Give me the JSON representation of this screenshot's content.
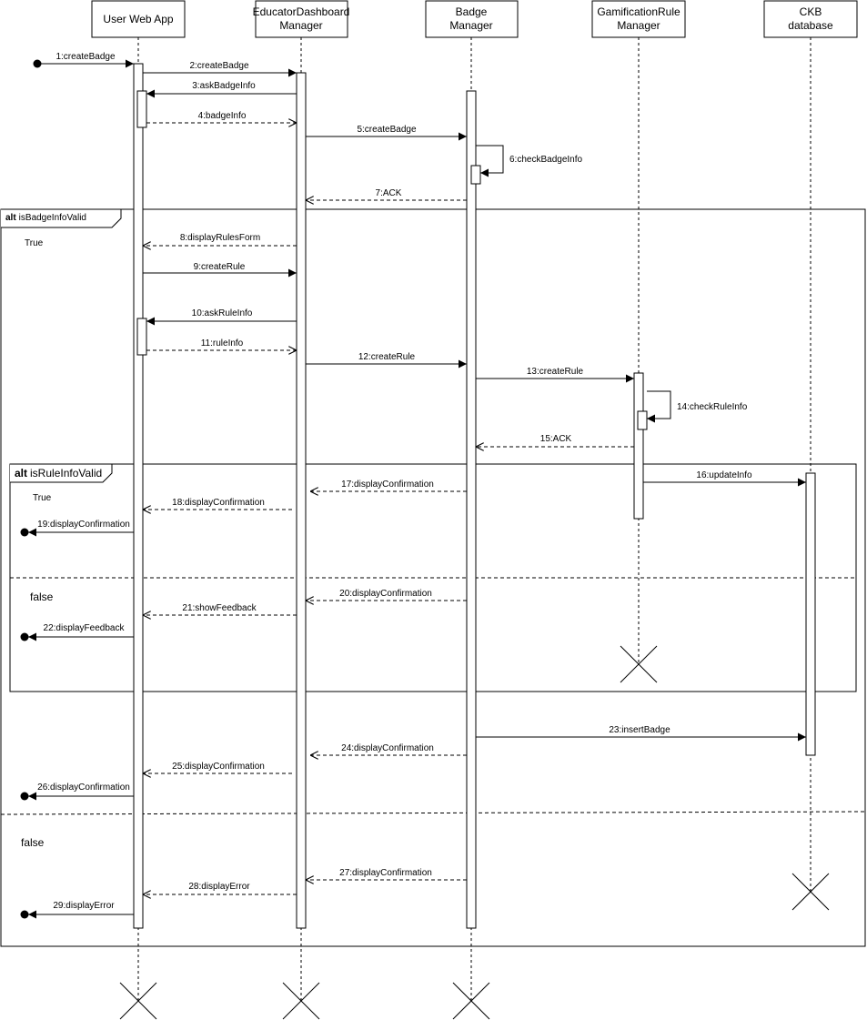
{
  "participants": [
    {
      "lines": [
        "User Web App"
      ]
    },
    {
      "lines": [
        "EducatorDashboard",
        "Manager"
      ]
    },
    {
      "lines": [
        "Badge",
        "Manager"
      ]
    },
    {
      "lines": [
        "GamificationRule",
        "Manager"
      ]
    },
    {
      "lines": [
        "CKB",
        "database"
      ]
    }
  ],
  "frames": {
    "outer": {
      "keyword": "alt",
      "condition": "isBadgeInfoValid",
      "guard_true": "True",
      "guard_false": "false"
    },
    "inner": {
      "keyword": "alt",
      "condition": "isRuleInfoValid",
      "guard_true": "True",
      "guard_false": "false"
    }
  },
  "messages": [
    "1:createBadge",
    "2:createBadge",
    "3:askBadgeInfo",
    "4:badgeInfo",
    "5:createBadge",
    "6:checkBadgeInfo",
    "7:ACK",
    "8:displayRulesForm",
    "9:createRule",
    "10:askRuleInfo",
    "11:ruleInfo",
    "12:createRule",
    "13:createRule",
    "14:checkRuleInfo",
    "15:ACK",
    "16:updateInfo",
    "17:displayConfirmation",
    "18:displayConfirmation",
    "19:displayConfirmation",
    "20:displayConfirmation",
    "21:showFeedback",
    "22:displayFeedback",
    "23:insertBadge",
    "24:displayConfirmation",
    "25:displayConfirmation",
    "26:displayConfirmation",
    "27:displayConfirmation",
    "28:displayError",
    "29:displayError"
  ]
}
